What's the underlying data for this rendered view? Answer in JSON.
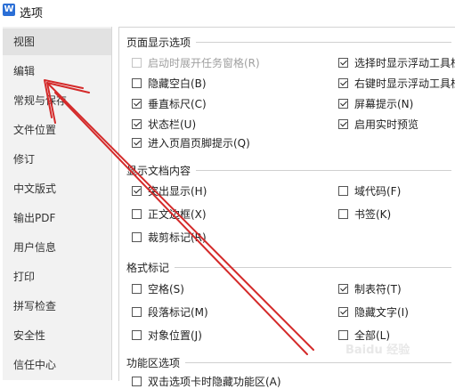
{
  "window": {
    "title": "选项"
  },
  "sidebar": {
    "items": [
      {
        "label": "视图"
      },
      {
        "label": "编辑"
      },
      {
        "label": "常规与保存"
      },
      {
        "label": "文件位置"
      },
      {
        "label": "修订"
      },
      {
        "label": "中文版式"
      },
      {
        "label": "输出PDF"
      },
      {
        "label": "用户信息"
      },
      {
        "label": "打印"
      },
      {
        "label": "拼写检查"
      },
      {
        "label": "安全性"
      },
      {
        "label": "信任中心"
      }
    ]
  },
  "sections": {
    "page_display": {
      "title": "页面显示选项",
      "options": [
        {
          "label": "启动时展开任务窗格(R)",
          "checked": false,
          "disabled": true
        },
        {
          "label": "隐藏空白(B)",
          "checked": false
        },
        {
          "label": "垂直标尺(C)",
          "checked": true
        },
        {
          "label": "状态栏(U)",
          "checked": true
        },
        {
          "label": "进入页眉页脚提示(Q)",
          "checked": true
        },
        {
          "label": "选择时显示浮动工具栏",
          "checked": true
        },
        {
          "label": "右键时显示浮动工具栏",
          "checked": true
        },
        {
          "label": "屏幕提示(N)",
          "checked": true
        },
        {
          "label": "启用实时预览",
          "checked": true
        }
      ]
    },
    "doc_content": {
      "title": "显示文档内容",
      "options": [
        {
          "label": "突出显示(H)",
          "checked": true
        },
        {
          "label": "正文边框(X)",
          "checked": false
        },
        {
          "label": "裁剪标记(R)",
          "checked": false
        },
        {
          "label": "域代码(F)",
          "checked": false
        },
        {
          "label": "书签(K)",
          "checked": false
        }
      ]
    },
    "format_marks": {
      "title": "格式标记",
      "options": [
        {
          "label": "空格(S)",
          "checked": false
        },
        {
          "label": "段落标记(M)",
          "checked": false
        },
        {
          "label": "对象位置(J)",
          "checked": false
        },
        {
          "label": "制表符(T)",
          "checked": true
        },
        {
          "label": "隐藏文字(I)",
          "checked": true
        },
        {
          "label": "全部(L)",
          "checked": false
        }
      ]
    },
    "ribbon": {
      "title": "功能区选项",
      "options": [
        {
          "label": "双击选项卡时隐藏功能区(A)",
          "checked": false
        }
      ]
    }
  },
  "watermark": "Baidu 经验",
  "colors": {
    "arrow": "#d42a2a",
    "sidebar_bg": "#f2f2f2",
    "active_item_bg": "#e2e2e2"
  }
}
